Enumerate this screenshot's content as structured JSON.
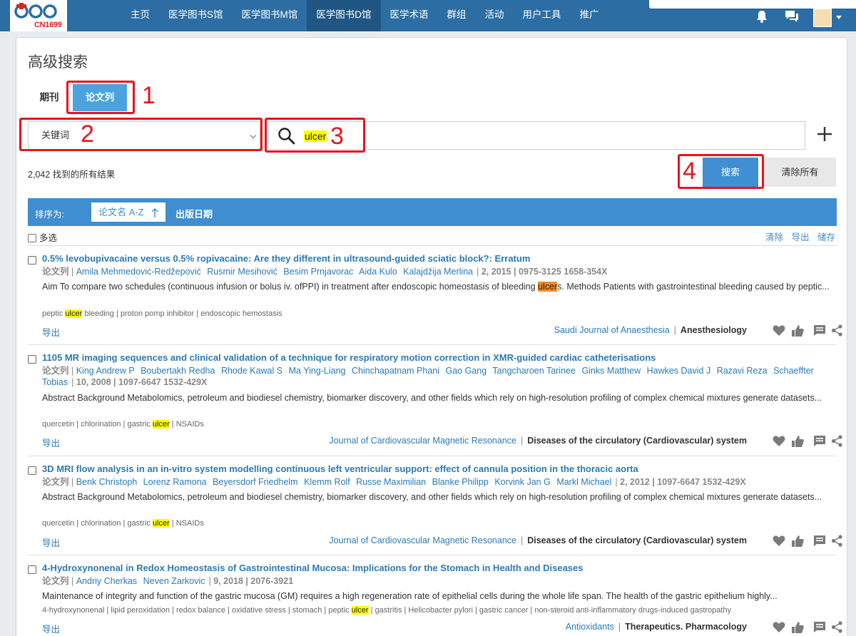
{
  "brand": {
    "name": "CN1699"
  },
  "nav": {
    "items": [
      {
        "label": "主页"
      },
      {
        "label": "医学图书S馆"
      },
      {
        "label": "医学图书M馆"
      },
      {
        "label": "医学图书D馆"
      },
      {
        "label": "医学术语"
      },
      {
        "label": "群组"
      },
      {
        "label": "活动"
      },
      {
        "label": "用户工具"
      },
      {
        "label": "推广"
      }
    ],
    "active_index": 3
  },
  "page": {
    "title": "高级搜索"
  },
  "tabs": [
    {
      "label": "期刊"
    },
    {
      "label": "论文列"
    }
  ],
  "search": {
    "field_select": "关键词",
    "query": "ulcer",
    "search_button": "搜索",
    "clear_button": "清除所有"
  },
  "results": {
    "count_text": "2,042 找到的所有结果"
  },
  "sort": {
    "label": "排序为:",
    "option_title": "论文名 A-Z",
    "option_date": "出版日期"
  },
  "list_toolbar": {
    "select_all": "多选",
    "clear": "清除",
    "export": "导出",
    "save": "储存"
  },
  "item_labels": {
    "type": "论文列",
    "export": "导出"
  },
  "items": [
    {
      "title": "0.5% levobupivacaine versus 0.5% ropivacaine: Are they different in ultrasound-guided sciatic block?: Erratum",
      "authors": [
        "Amila Mehmedović-Redžepović",
        "Rusmir Mesihović",
        "Besim Prnjavorac",
        "Aida Kulo",
        "Kalajdžija Merlina"
      ],
      "pub": "2, 2015 | 0975-3125 1658-354X",
      "abstract_before": "Aim To compare two schedules (continuous infusion or bolus iv. ofPPI) in treatment after endoscopic homeostasis of bleeding ",
      "abstract_hl": "ulcer",
      "abstract_after": "s. Methods Patients with gastrointestinal bleeding caused by peptic...",
      "kw_before": "peptic ",
      "kw_hl": "ulcer",
      "kw_after": " bleeding | proton pomp inhibitor | endoscopic hemostasis",
      "journal": "Saudi Journal of Anaesthesia",
      "subject": "Anesthesiology"
    },
    {
      "title": "1105 MR imaging sequences and clinical validation of a technique for respiratory motion correction in XMR-guided cardiac catheterisations",
      "authors": [
        "King Andrew P",
        "Boubertakh Redha",
        "Rhode Kawal S",
        "Ma Ying-Liang",
        "Chinchapatnam Phani",
        "Gao Gang",
        "Tangcharoen Tarinee",
        "Ginks Matthew",
        "Hawkes David J",
        "Razavi Reza",
        "Schaeffter Tobias"
      ],
      "pub": "10, 2008 | 1097-6647 1532-429X",
      "abstract_before": "Abstract Background Metabolomics, petroleum and biodiesel chemistry, biomarker discovery, and other fields which rely on high-resolution profiling of complex chemical mixtures generate datasets...",
      "abstract_hl": "",
      "abstract_after": "",
      "kw_before": "quercetin | chlorination | gastric ",
      "kw_hl": "ulcer",
      "kw_after": " | NSAIDs",
      "journal": "Journal of Cardiovascular Magnetic Resonance",
      "subject": "Diseases of the circulatory (Cardiovascular) system"
    },
    {
      "title": "3D MRI flow analysis in an in-vitro system modelling continuous left ventricular support: effect of cannula position in the thoracic aorta",
      "authors": [
        "Benk Christoph",
        "Lorenz Ramona",
        "Beyersdorf Friedhelm",
        "Klemm Rolf",
        "Russe Maximilian",
        "Blanke Philipp",
        "Korvink Jan G",
        "Markl Michael"
      ],
      "pub": "2, 2012 | 1097-6647 1532-429X",
      "abstract_before": "Abstract Background Metabolomics, petroleum and biodiesel chemistry, biomarker discovery, and other fields which rely on high-resolution profiling of complex chemical mixtures generate datasets...",
      "abstract_hl": "",
      "abstract_after": "",
      "kw_before": "quercetin | chlorination | gastric ",
      "kw_hl": "ulcer",
      "kw_after": " | NSAIDs",
      "journal": "Journal of Cardiovascular Magnetic Resonance",
      "subject": "Diseases of the circulatory (Cardiovascular) system"
    },
    {
      "title": "4-Hydroxynonenal in Redox Homeostasis of Gastrointestinal Mucosa: Implications for the Stomach in Health and Diseases",
      "authors": [
        "Andriy Cherkas",
        "Neven Zarkovic"
      ],
      "pub": "9, 2018 | 2076-3921",
      "abstract_before": "Maintenance of integrity and function of the gastric mucosa (GM) requires a high regeneration rate of epithelial cells during the whole life span. The health of the gastric epithelium highly...",
      "abstract_hl": "",
      "abstract_after": "",
      "kw_before": "4-hydroxynonenal | lipid peroxidation | redox balance | oxidative stress | stomach | peptic ",
      "kw_hl": "ulcer",
      "kw_after": " | gastritis | Helicobacter pylori | gastric cancer | non-steroid anti-inflammatory drugs-induced gastropathy",
      "journal": "Antioxidants",
      "subject": "Therapeutics. Pharmacology"
    }
  ],
  "annotations": [
    "1",
    "2",
    "3",
    "4"
  ],
  "colors": {
    "nav_bg": "#2c6da3",
    "accent": "#3e8ed0",
    "link": "#2a7ab8",
    "annotation": "#e8141c",
    "highlight": "#ffff00",
    "highlight_strong": "#f08c2c"
  }
}
